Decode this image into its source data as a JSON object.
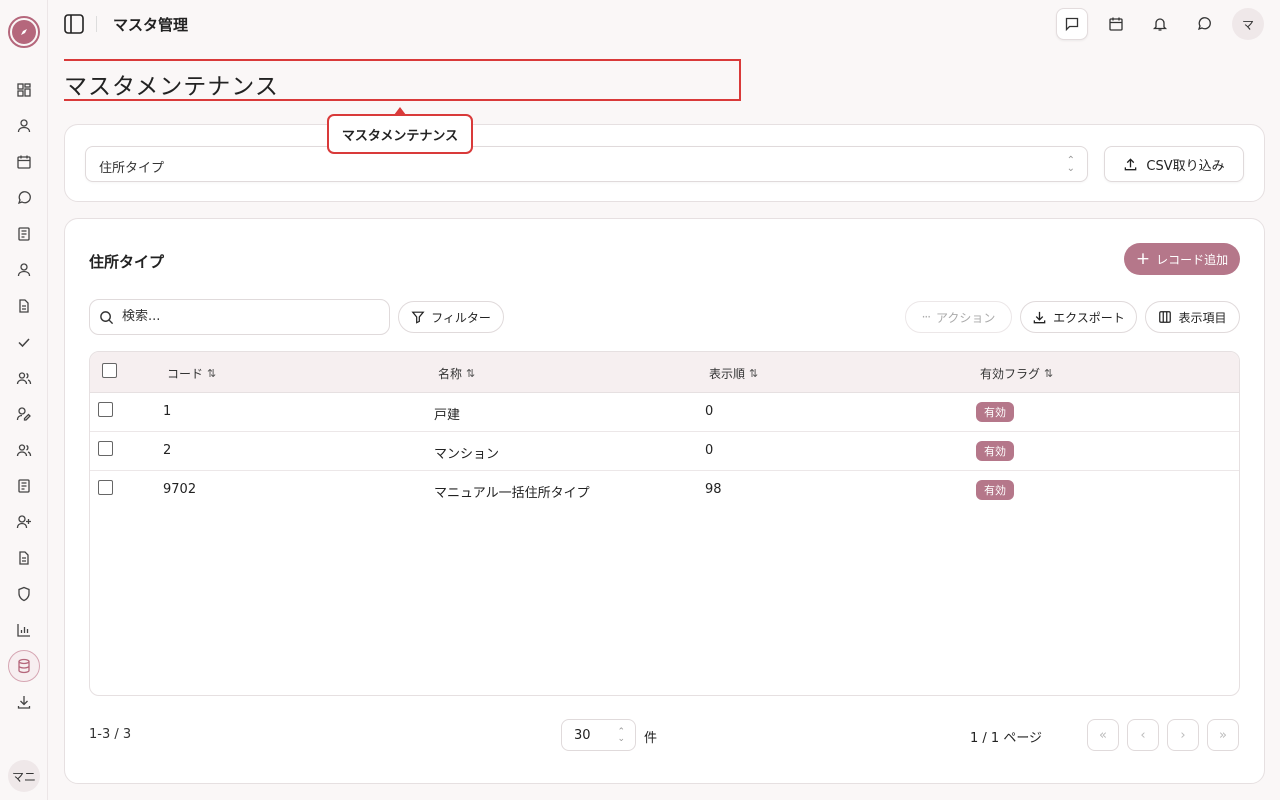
{
  "header": {
    "title": "マスタ管理",
    "user_initial": "マ"
  },
  "sidebar": {
    "user_initials": "マニ"
  },
  "page": {
    "title": "マスタメンテナンス",
    "tooltip": "マスタメンテナンス"
  },
  "master_select": {
    "value": "住所タイプ",
    "csv_label": "CSV取り込み"
  },
  "section": {
    "title": "住所タイプ",
    "add_label": "レコード追加"
  },
  "toolbar": {
    "search_placeholder": "検索...",
    "filter_label": "フィルター",
    "action_label": "アクション",
    "export_label": "エクスポート",
    "columns_label": "表示項目"
  },
  "table": {
    "headers": {
      "code": "コード",
      "name": "名称",
      "order": "表示順",
      "flag": "有効フラグ"
    },
    "rows": [
      {
        "code": "1",
        "name": "戸建",
        "order": "0",
        "flag": "有効"
      },
      {
        "code": "2",
        "name": "マンション",
        "order": "0",
        "flag": "有効"
      },
      {
        "code": "9702",
        "name": "マニュアル一括住所タイプ",
        "order": "98",
        "flag": "有効"
      }
    ]
  },
  "pagination": {
    "range": "1-3 / 3",
    "page_size": "30",
    "unit": "件",
    "page_info": "1 / 1 ページ"
  },
  "colors": {
    "accent": "#b5778a",
    "highlight": "#d93a3a"
  }
}
